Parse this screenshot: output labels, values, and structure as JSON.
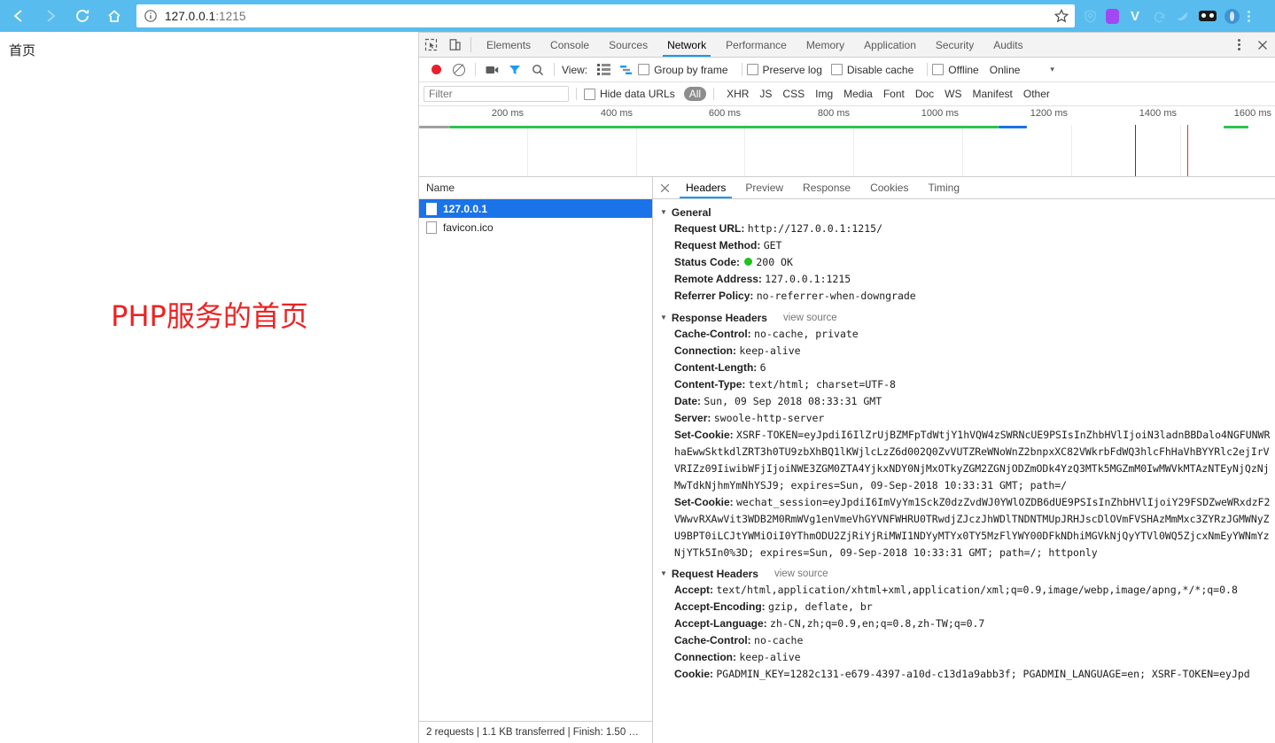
{
  "browser": {
    "back_icon": "arrow-left-icon",
    "forward_icon": "arrow-right-icon",
    "reload_icon": "reload-icon",
    "home_icon": "home-icon",
    "url_host": "127.0.0.1",
    "url_port": ":1215",
    "info_icon": "info-circle-icon",
    "star_icon": "bookmark-star-icon",
    "extensions": [
      "shield-icon",
      "purple-extension-icon",
      "v-extension-icon",
      "arrow-extension-icon",
      "bird-extension-icon",
      "mask-extension-icon",
      "opera-extension-icon"
    ],
    "menu_icon": "browser-menu-icon"
  },
  "page": {
    "tab_title": "首页",
    "headline": "PHP服务的首页"
  },
  "devtools": {
    "inspect_icon": "inspect-element-icon",
    "device_toolbar_icon": "device-toolbar-icon",
    "tabs": [
      {
        "label": "Elements",
        "active": false
      },
      {
        "label": "Console",
        "active": false
      },
      {
        "label": "Sources",
        "active": false
      },
      {
        "label": "Network",
        "active": true
      },
      {
        "label": "Performance",
        "active": false
      },
      {
        "label": "Memory",
        "active": false
      },
      {
        "label": "Application",
        "active": false
      },
      {
        "label": "Security",
        "active": false
      },
      {
        "label": "Audits",
        "active": false
      }
    ],
    "more_icon": "devtools-more-icon",
    "close_icon": "devtools-close-icon",
    "toolbar": {
      "record_icon": "record-stop-icon",
      "clear_icon": "clear-icon",
      "capture_screenshots_icon": "camera-icon",
      "filter_icon": "funnel-icon",
      "search_icon": "search-icon",
      "view_label": "View:",
      "view_list_icon": "list-view-icon",
      "view_waterfall_icon": "waterfall-view-icon",
      "group_by_frame": "Group by frame",
      "preserve_log": "Preserve log",
      "disable_cache": "Disable cache",
      "offline": "Offline",
      "throttling": "Online",
      "throttling_caret": "▾"
    },
    "filterbar": {
      "placeholder": "Filter",
      "hide_data_urls": "Hide data URLs",
      "types": [
        "All",
        "XHR",
        "JS",
        "CSS",
        "Img",
        "Media",
        "Font",
        "Doc",
        "WS",
        "Manifest",
        "Other"
      ],
      "active_type": "All"
    },
    "overview": {
      "ticks": [
        "200 ms",
        "400 ms",
        "600 ms",
        "800 ms",
        "1000 ms",
        "1200 ms",
        "1400 ms",
        "1600 ms"
      ],
      "bar_color_green": "#2dc44d",
      "bar_color_blue": "#1a73e8",
      "bar_color_grey": "#a0a0a0",
      "dom_marker_color": "#3131c9",
      "load_marker_color": "#d23b3b"
    },
    "requests": {
      "column_name": "Name",
      "rows": [
        {
          "name": "127.0.0.1",
          "selected": true
        },
        {
          "name": "favicon.ico",
          "selected": false
        }
      ]
    },
    "status_bar": "2 requests | 1.1 KB transferred | Finish: 1.50 …",
    "detail_tabs": [
      {
        "label": "Headers",
        "active": true
      },
      {
        "label": "Preview",
        "active": false
      },
      {
        "label": "Response",
        "active": false
      },
      {
        "label": "Cookies",
        "active": false
      },
      {
        "label": "Timing",
        "active": false
      }
    ],
    "detail_close_icon": "detail-close-icon",
    "sections": {
      "general": {
        "title": "General",
        "items": [
          {
            "key": "Request URL:",
            "value": "http://127.0.0.1:1215/"
          },
          {
            "key": "Request Method:",
            "value": "GET"
          },
          {
            "key": "Status Code:",
            "value": "200 OK",
            "status_dot": true
          },
          {
            "key": "Remote Address:",
            "value": "127.0.0.1:1215"
          },
          {
            "key": "Referrer Policy:",
            "value": "no-referrer-when-downgrade"
          }
        ]
      },
      "response_headers": {
        "title": "Response Headers",
        "view_source": "view source",
        "items": [
          {
            "key": "Cache-Control:",
            "value": "no-cache, private"
          },
          {
            "key": "Connection:",
            "value": "keep-alive"
          },
          {
            "key": "Content-Length:",
            "value": "6"
          },
          {
            "key": "Content-Type:",
            "value": "text/html; charset=UTF-8"
          },
          {
            "key": "Date:",
            "value": "Sun, 09 Sep 2018 08:33:31 GMT"
          },
          {
            "key": "Server:",
            "value": "swoole-http-server"
          },
          {
            "key": "Set-Cookie:",
            "value": "XSRF-TOKEN=eyJpdiI6IlZrUjBZMFpTdWtjY1hVQW4zSWRNcUE9PSIsInZhbHVlIjoiN3ladnBBDalo4NGFUNWRhaEwwSktkdlZRT3h0TU9zbXhBQ1lKWjlcLzZ6d002Q0ZvVUTZReWNoWnZ2bnpxXC82VWkrbFdWQ3hlcFhHaVhBYYRlc2ejIrVVRIZz09IiwibWFjIjoiNWE3ZGM0ZTA4YjkxNDY0NjMxOTkyZGM2ZGNjODZmODk4YzQ3MTk5MGZmM0IwMWVkMTAzNTEyNjQzNjMwTdkNjhmYmNhYSJ9; expires=Sun, 09-Sep-2018 10:33:31 GMT; path=/"
          },
          {
            "key": "Set-Cookie:",
            "value": "wechat_session=eyJpdiI6ImVyYm1SckZ0dzZvdWJ0YWlOZDB6dUE9PSIsInZhbHVlIjoiY29FSDZweWRxdzF2VWwvRXAwVit3WDB2M0RmWVg1enVmeVhGYVNFWHRU0TRwdjZJczJhWDlTNDNTMUpJRHJscDlOVmFVSHAzMmMxc3ZYRzJGMWNyZU9BPT0iLCJtYWMiOiI0YThmODU2ZjRiYjRiMWI1NDYyMTYx0TY5MzFlYWY00DFkNDhiMGVkNjQyYTVl0WQ5ZjcxNmEyYWNmYzNjYTk5In0%3D; expires=Sun, 09-Sep-2018 10:33:31 GMT; path=/; httponly"
          }
        ]
      },
      "request_headers": {
        "title": "Request Headers",
        "view_source": "view source",
        "items": [
          {
            "key": "Accept:",
            "value": "text/html,application/xhtml+xml,application/xml;q=0.9,image/webp,image/apng,*/*;q=0.8"
          },
          {
            "key": "Accept-Encoding:",
            "value": "gzip, deflate, br"
          },
          {
            "key": "Accept-Language:",
            "value": "zh-CN,zh;q=0.9,en;q=0.8,zh-TW;q=0.7"
          },
          {
            "key": "Cache-Control:",
            "value": "no-cache"
          },
          {
            "key": "Connection:",
            "value": "keep-alive"
          },
          {
            "key": "Cookie:",
            "value": "PGADMIN_KEY=1282c131-e679-4397-a10d-c13d1a9abb3f; PGADMIN_LANGUAGE=en; XSRF-TOKEN=eyJpd"
          }
        ]
      }
    }
  }
}
